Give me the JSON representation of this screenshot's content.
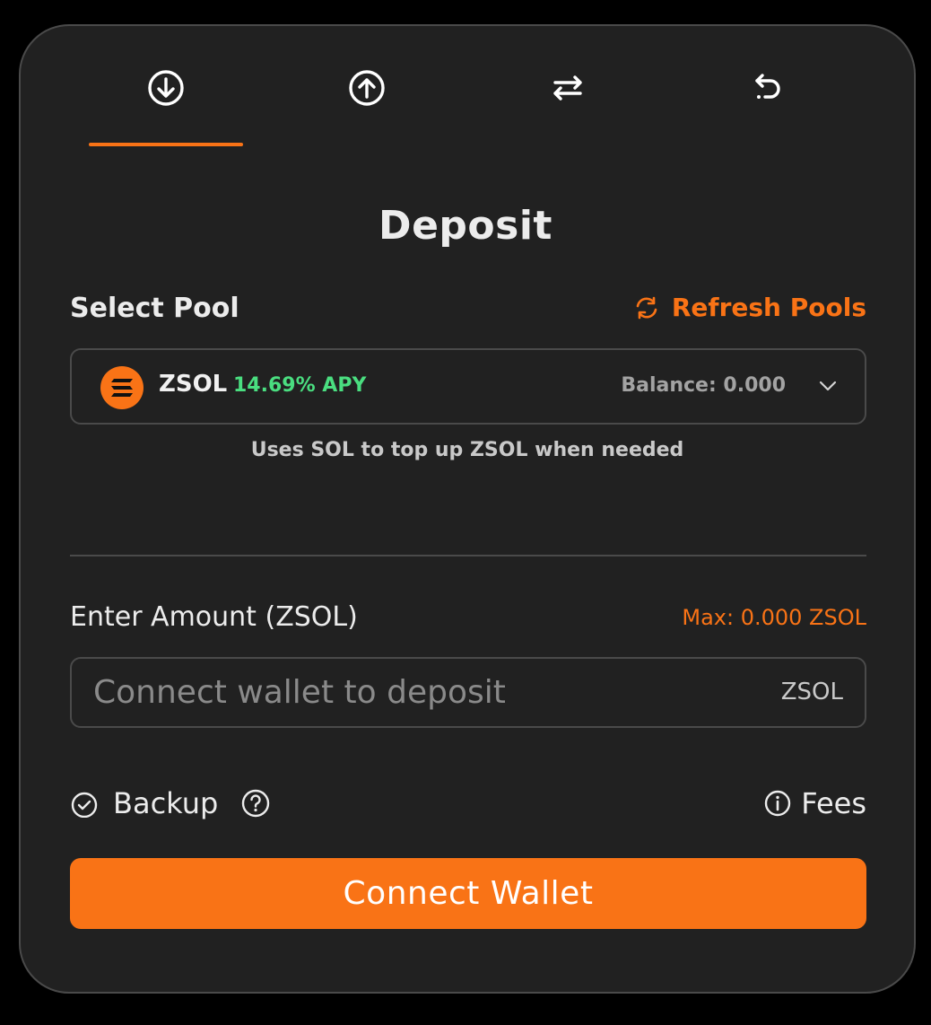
{
  "tabs": [
    {
      "icon": "arrow-down-circle-icon",
      "active": true
    },
    {
      "icon": "arrow-up-circle-icon",
      "active": false
    },
    {
      "icon": "swap-arrows-icon",
      "active": false
    },
    {
      "icon": "undo-arrow-icon",
      "active": false
    }
  ],
  "title": "Deposit",
  "pool_section": {
    "label": "Select Pool",
    "refresh_label": "Refresh Pools",
    "refresh_icon": "refresh-icon"
  },
  "pool": {
    "symbol": "ZSOL",
    "apy": "14.69% APY",
    "balance": "Balance: 0.000",
    "logo_icon": "solana-logo-icon"
  },
  "hint": "Uses SOL to top up ZSOL when needed",
  "amount": {
    "label": "Enter Amount (ZSOL)",
    "max_label": "Max: 0.000 ZSOL",
    "placeholder": "Connect wallet to deposit",
    "value": "",
    "unit": "ZSOL"
  },
  "options": {
    "backup_label": "Backup",
    "fees_label": "Fees"
  },
  "connect_button": "Connect Wallet",
  "colors": {
    "accent": "#f97316",
    "apy_green": "#4ade80",
    "card_bg": "#212121",
    "border": "#4a4a4a"
  }
}
